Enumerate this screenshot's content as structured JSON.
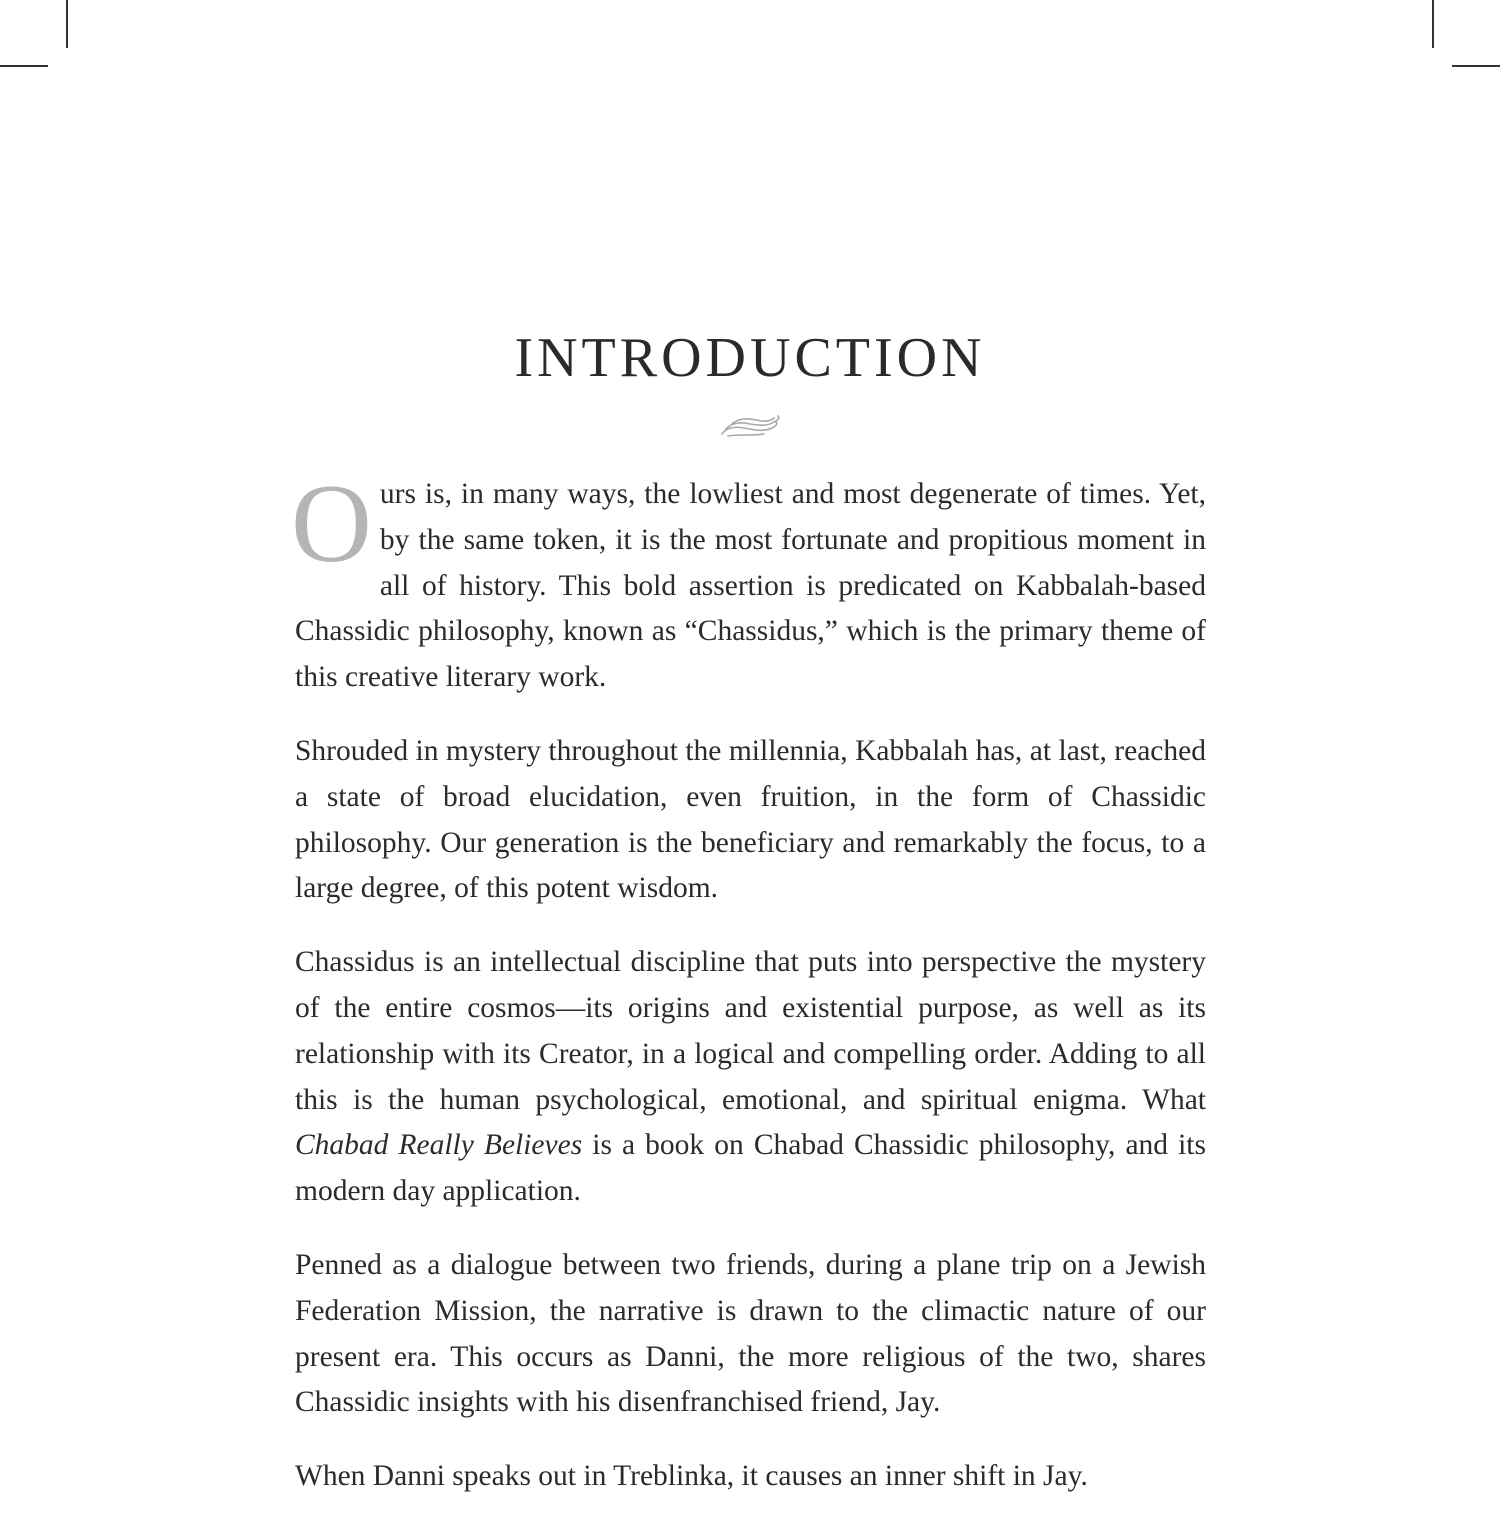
{
  "page": {
    "title": "INTRODUCTION",
    "ornament_icon": "flourish-ornament-icon",
    "dropcap_color": "#b5b5b5",
    "paragraphs": [
      {
        "dropcap": "O",
        "text": "urs is, in many ways, the lowliest and most degenerate of times. Yet, by the same token, it is the most fortunate and propitious moment in all of history. This bold assertion is predicated on Kabbalah-based Chassidic philosophy, known as “Chassidus,” which is the primary theme of this creative literary work."
      },
      {
        "text": "Shrouded in mystery throughout the millennia, Kabbalah has, at last, reached a state of broad elucidation, even fruition, in the form of Chassidic philosophy. Our generation is the beneficiary and remarkably the focus, to a large degree, of this potent wisdom."
      },
      {
        "text_before": "Chassidus is an intellectual discipline that puts into perspective the mystery of the entire cosmos—its origins and existential purpose, as well as its relationship with its Creator, in a logical and compelling order. Adding to all this is the human psychological, emotional, and spiritual enigma. What ",
        "italic": "Chabad Really Believes",
        "text_after": " is a book on Chabad Chassidic philosophy, and its modern day application."
      },
      {
        "text": "Penned as a dialogue between two friends, during a plane trip on a Jewish Federation Mission, the narrative is drawn to the climactic nature of our present era. This occurs as Danni, the more religious of the two, shares Chassidic insights with his disenfranchised friend, Jay."
      },
      {
        "text": "When Danni speaks out in Treblinka, it causes an inner shift in Jay."
      }
    ]
  }
}
